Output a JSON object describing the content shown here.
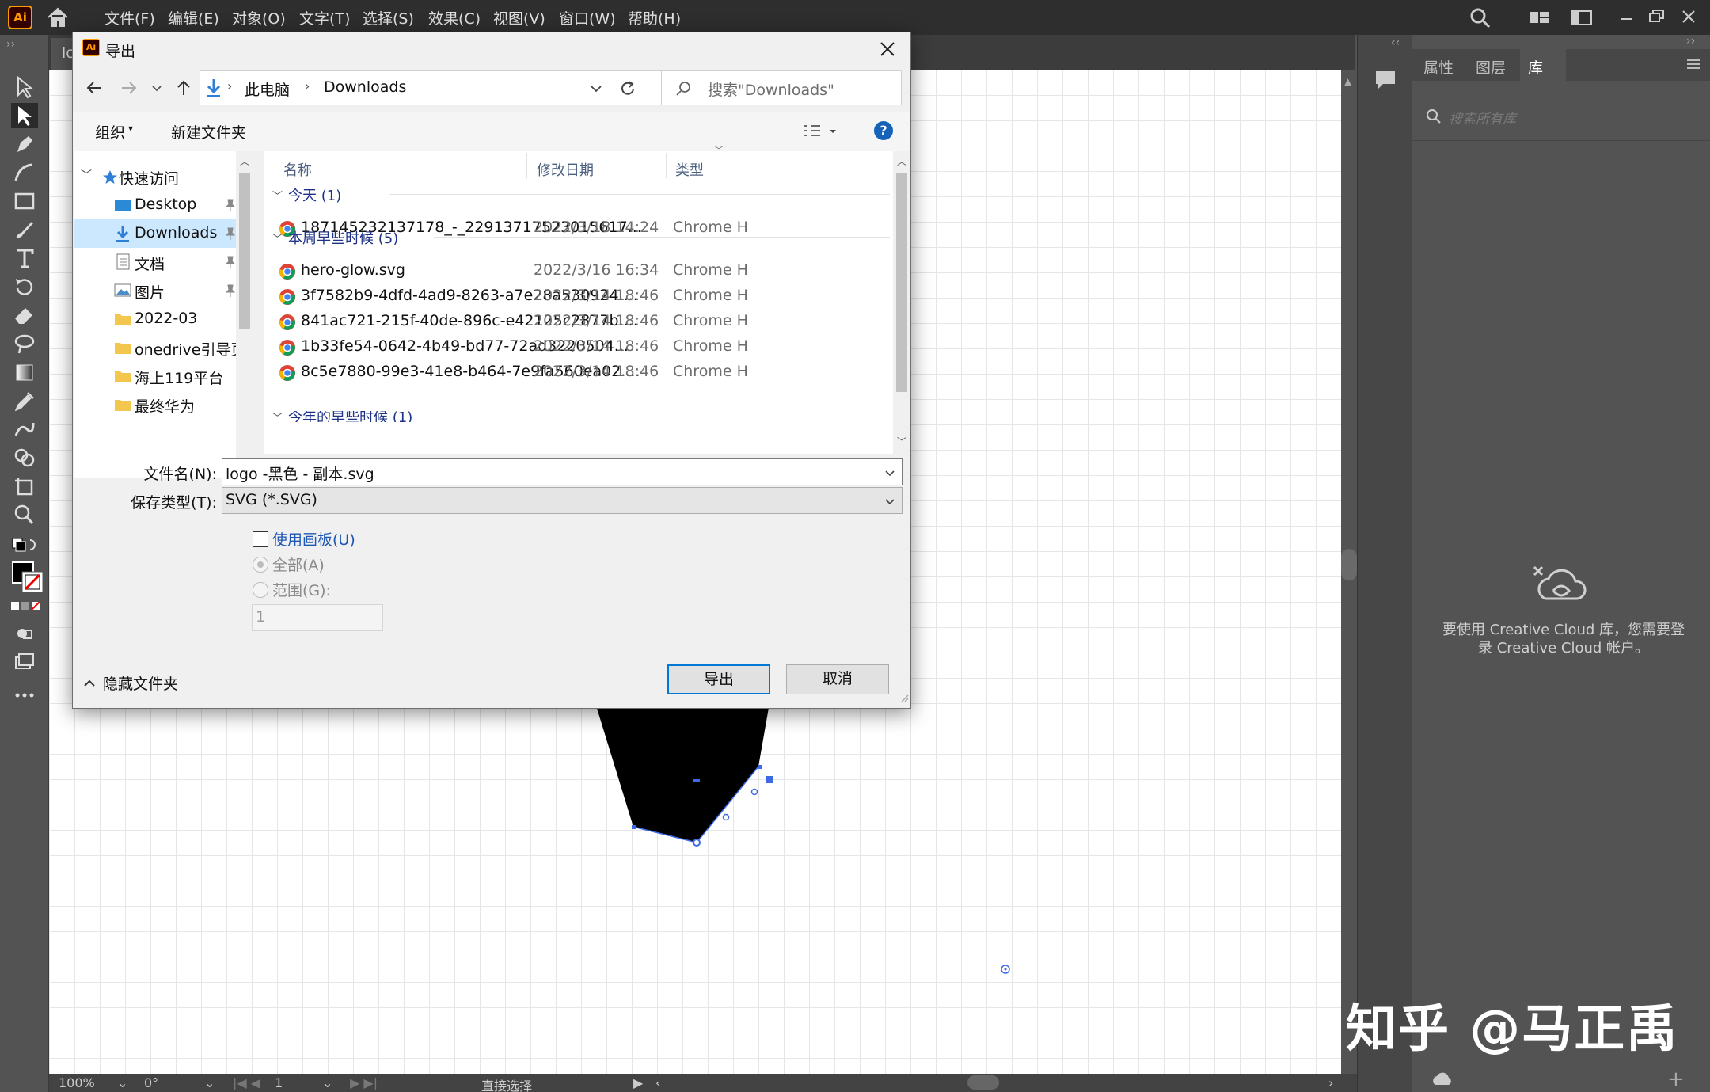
{
  "app": {
    "logo_text": "Ai",
    "menu": [
      "文件(F)",
      "编辑(E)",
      "对象(O)",
      "文字(T)",
      "选择(S)",
      "效果(C)",
      "视图(V)",
      "窗口(W)",
      "帮助(H)"
    ]
  },
  "document": {
    "tab_label": "lo"
  },
  "status_bar": {
    "zoom": "100%",
    "rotation": "0°",
    "artboard": "1",
    "tool": "直接选择"
  },
  "right_panel": {
    "tabs": [
      "属性",
      "图层",
      "库"
    ],
    "active_tab": "库",
    "search_placeholder": "搜索所有库",
    "cc_message": "要使用 Creative Cloud 库，您需要登录 Creative Cloud 帐户。"
  },
  "watermark": "知乎 @马正禹",
  "dialog": {
    "title": "导出",
    "breadcrumb": [
      "此电脑",
      "Downloads"
    ],
    "search_placeholder": "搜索\"Downloads\"",
    "toolbar": {
      "organize": "组织",
      "new_folder": "新建文件夹"
    },
    "nav_tree": [
      {
        "label": "快速访问",
        "type": "star",
        "pinned": false,
        "selected": false
      },
      {
        "label": "Desktop",
        "type": "desktop",
        "pinned": true,
        "selected": false
      },
      {
        "label": "Downloads",
        "type": "download",
        "pinned": true,
        "selected": true
      },
      {
        "label": "文档",
        "type": "doc",
        "pinned": true,
        "selected": false
      },
      {
        "label": "图片",
        "type": "pic",
        "pinned": true,
        "selected": false
      },
      {
        "label": "2022-03",
        "type": "folder",
        "pinned": false,
        "selected": false
      },
      {
        "label": "onedrive引导页",
        "type": "folder",
        "pinned": false,
        "selected": false
      },
      {
        "label": "海上119平台",
        "type": "folder",
        "pinned": false,
        "selected": false
      },
      {
        "label": "最终华为",
        "type": "folder",
        "pinned": false,
        "selected": false
      }
    ],
    "columns": {
      "name": "名称",
      "modified": "修改日期",
      "type": "类型"
    },
    "groups": [
      {
        "label": "今天 (1)",
        "files": [
          {
            "name": "187145232137178_-_22913717523015617...",
            "date": "2022/3/18 14:24",
            "type": "Chrome H"
          }
        ]
      },
      {
        "label": "本周早些时候 (5)",
        "files": [
          {
            "name": "hero-glow.svg",
            "date": "2022/3/16 16:34",
            "type": "Chrome H"
          },
          {
            "name": "3f7582b9-4dfd-4ad9-8263-a7e28a530924....",
            "date": "2022/3/14 18:46",
            "type": "Chrome H"
          },
          {
            "name": "841ac721-215f-40de-896c-e42125c2877b....",
            "date": "2022/3/14 18:46",
            "type": "Chrome H"
          },
          {
            "name": "1b33fe54-0642-4b49-bd77-72ad3220504...",
            "date": "2022/3/14 18:46",
            "type": "Chrome H"
          },
          {
            "name": "8c5e7880-99e3-41e8-b464-7e9fa560ea02....",
            "date": "2022/3/14 18:46",
            "type": "Chrome H"
          }
        ]
      },
      {
        "label": "今年的早些时候 (1)",
        "files": []
      }
    ],
    "filename_label": "文件名(N):",
    "filename_value": "logo -黑色 - 副本.svg",
    "filetype_label": "保存类型(T):",
    "filetype_value": "SVG (*.SVG)",
    "use_artboards_label": "使用画板(U)",
    "use_artboards_checked": false,
    "all_label": "全部(A)",
    "range_label": "范围(G):",
    "range_value": "1",
    "hide_folders_label": "隐藏文件夹",
    "export_button": "导出",
    "cancel_button": "取消"
  }
}
